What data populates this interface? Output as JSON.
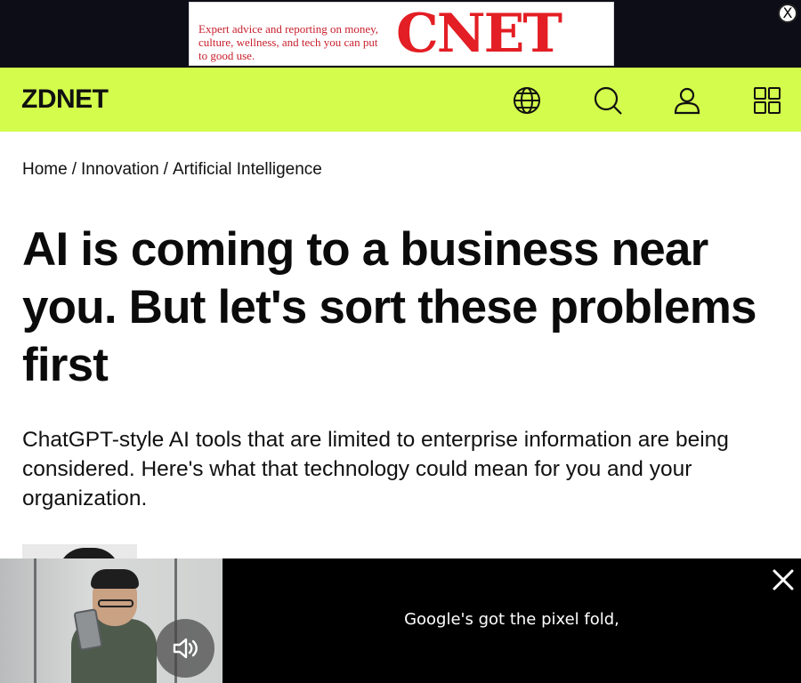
{
  "ad": {
    "text": "Expert advice and reporting on money, culture, wellness, and tech you can put to good use.",
    "logo": "CNET",
    "close_label": "X"
  },
  "header": {
    "logo": "ZDNET",
    "icons": [
      "globe-icon",
      "search-icon",
      "user-icon",
      "grid-menu-icon"
    ],
    "background": "#d3fc4c"
  },
  "breadcrumb": {
    "items": [
      "Home",
      "Innovation",
      "Artificial Intelligence"
    ],
    "separator": "/"
  },
  "article": {
    "headline": "AI is coming to a business near you. But let's sort these problems first",
    "dek": "ChatGPT-style AI tools that are limited to enterprise information are being considered. Here's what that technology could mean for you and your organization."
  },
  "video": {
    "caption": "Google's got the pixel fold,",
    "mute_icon": "speaker-muted-icon",
    "close_icon": "close-icon"
  }
}
